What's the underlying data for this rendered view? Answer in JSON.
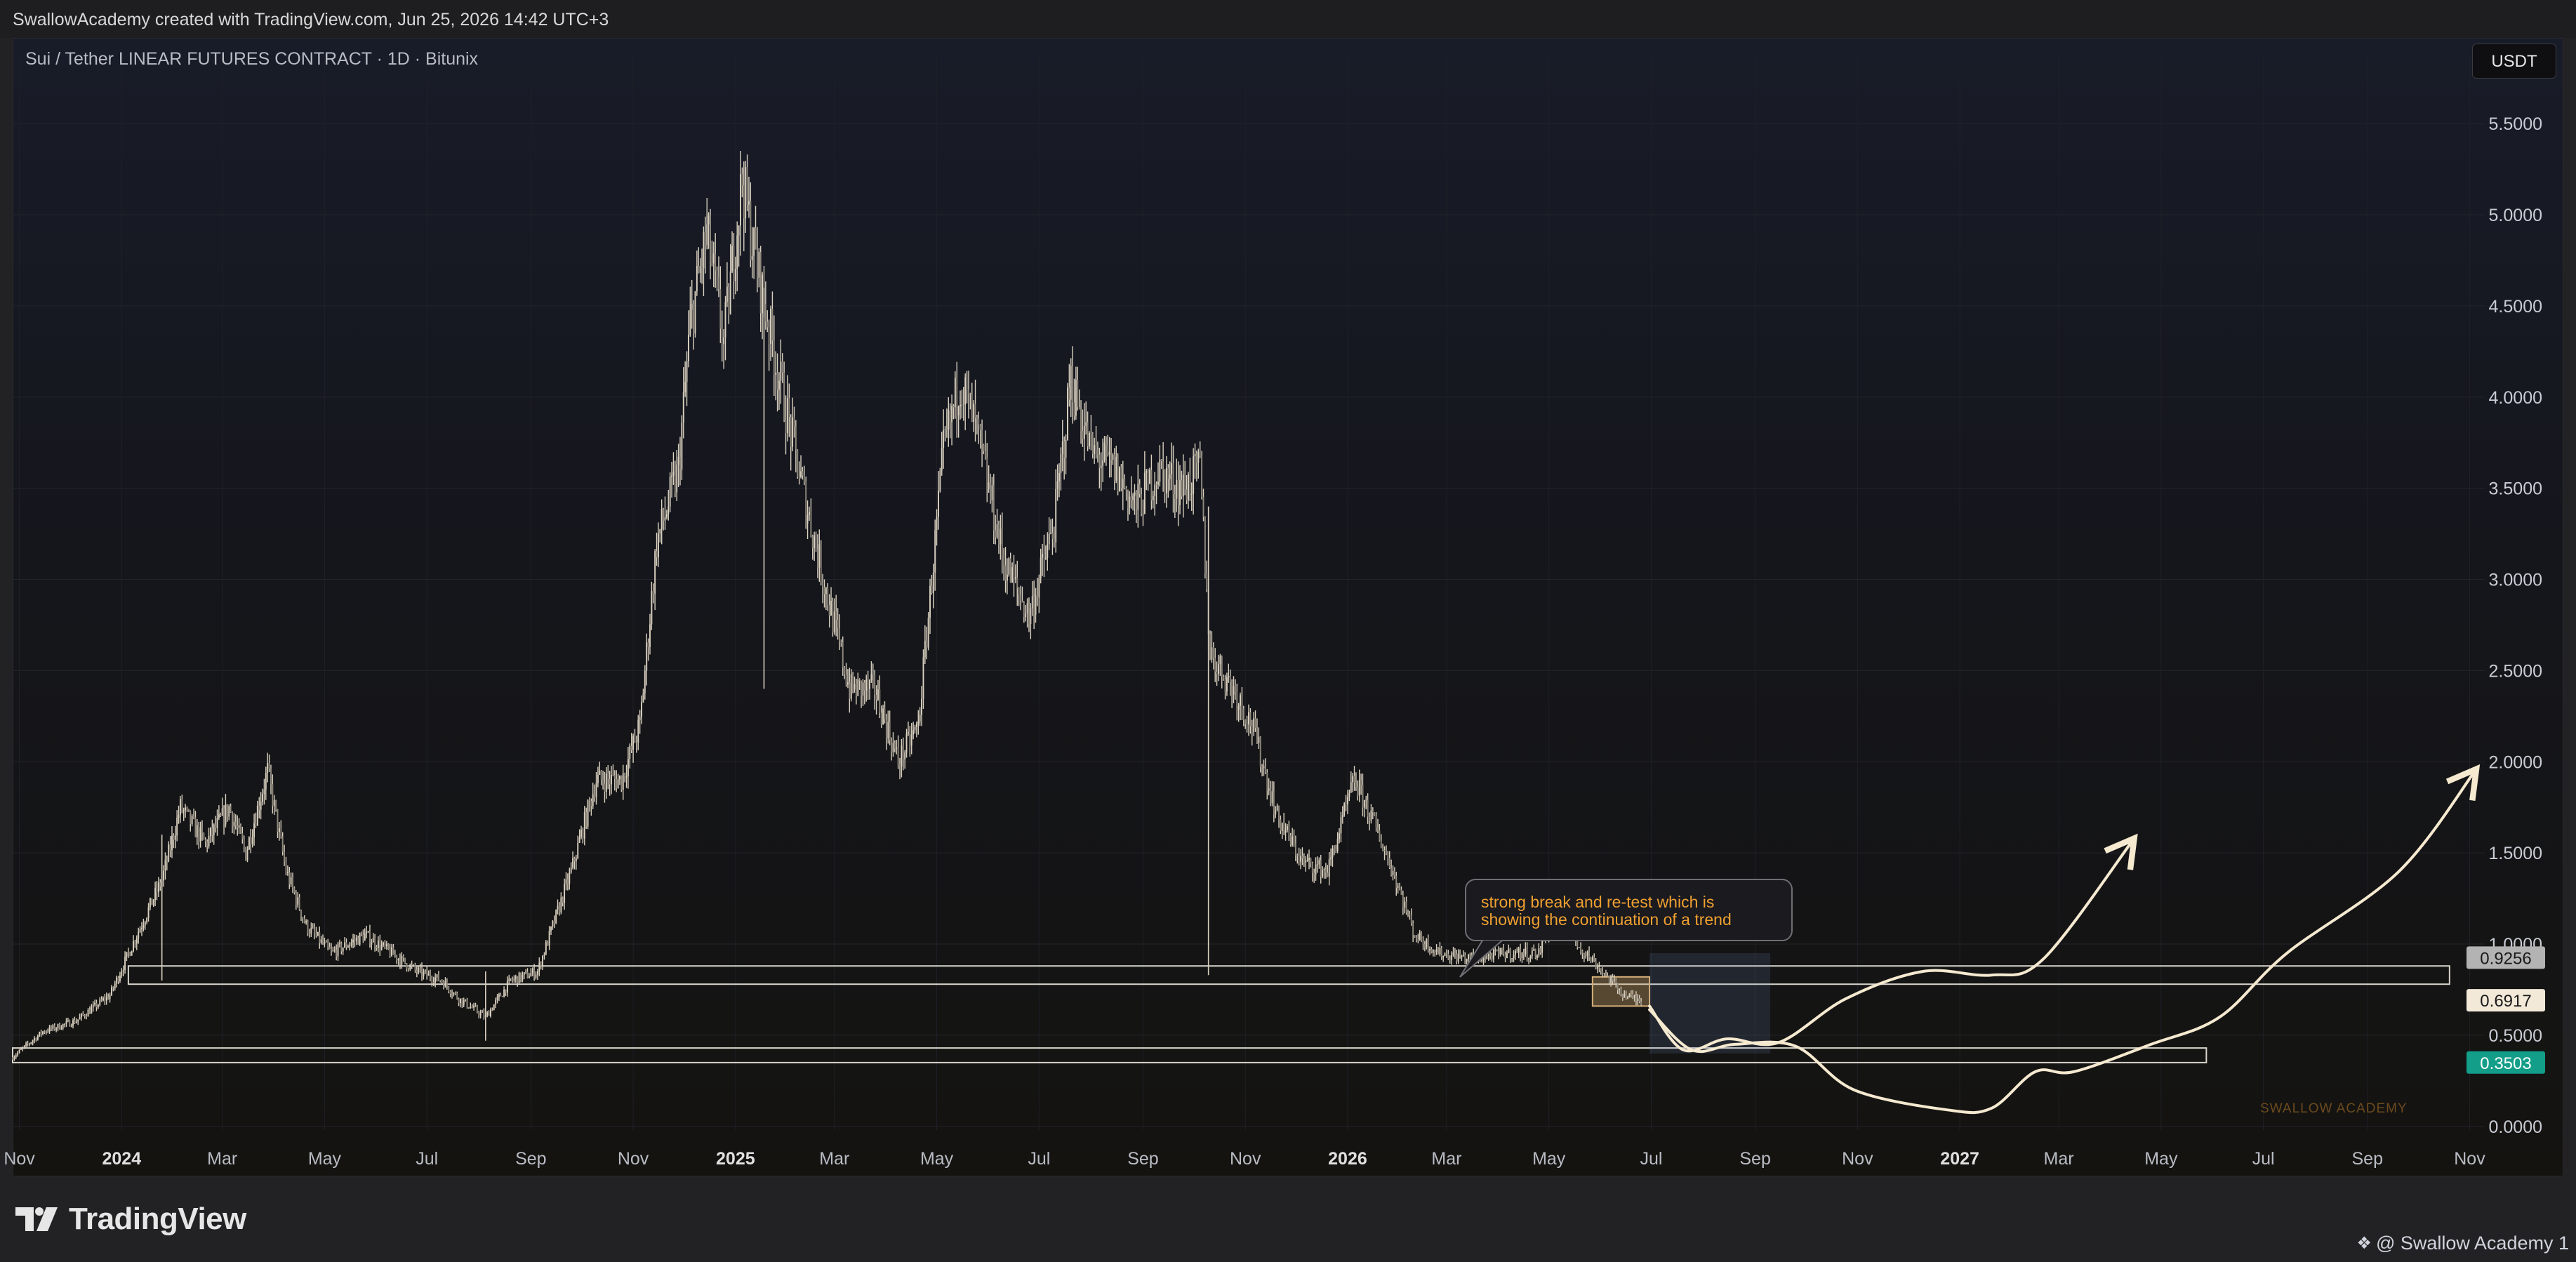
{
  "header": {
    "credit": "SwallowAcademy created with TradingView.com, Jun 25, 2026 14:42 UTC+3"
  },
  "symbol_title": "Sui / Tether LINEAR FUTURES CONTRACT · 1D · Bitunix",
  "currency_button": "USDT",
  "footer": {
    "brand": "TradingView",
    "user": "@ Swallow Academy 1"
  },
  "watermark": "SWALLOW ACADEMY",
  "annotation": {
    "line1": "strong break and re-test which is",
    "line2": "showing the continuation of a trend"
  },
  "colors": {
    "candle": "#d9d0bf",
    "accent_curve": "#f5e9d0",
    "annotation_text": "#f0a030",
    "price_label_green": "#129e89",
    "price_label_grey": "#b3b3b3",
    "price_label_cream": "#f2e9d8"
  },
  "chart_data": {
    "type": "line",
    "x_axis": {
      "range": [
        "2023-10-28",
        "2027-11-10"
      ],
      "tick_labels": [
        {
          "label": "Nov",
          "date": "2023-11-01",
          "bold": false
        },
        {
          "label": "2024",
          "date": "2024-01-01",
          "bold": true
        },
        {
          "label": "Mar",
          "date": "2024-03-01",
          "bold": false
        },
        {
          "label": "May",
          "date": "2024-05-01",
          "bold": false
        },
        {
          "label": "Jul",
          "date": "2024-07-01",
          "bold": false
        },
        {
          "label": "Sep",
          "date": "2024-09-01",
          "bold": false
        },
        {
          "label": "Nov",
          "date": "2024-11-01",
          "bold": false
        },
        {
          "label": "2025",
          "date": "2025-01-01",
          "bold": true
        },
        {
          "label": "Mar",
          "date": "2025-03-01",
          "bold": false
        },
        {
          "label": "May",
          "date": "2025-05-01",
          "bold": false
        },
        {
          "label": "Jul",
          "date": "2025-07-01",
          "bold": false
        },
        {
          "label": "Sep",
          "date": "2025-09-01",
          "bold": false
        },
        {
          "label": "Nov",
          "date": "2025-11-01",
          "bold": false
        },
        {
          "label": "2026",
          "date": "2026-01-01",
          "bold": true
        },
        {
          "label": "Mar",
          "date": "2026-03-01",
          "bold": false
        },
        {
          "label": "May",
          "date": "2026-05-01",
          "bold": false
        },
        {
          "label": "Jul",
          "date": "2026-07-01",
          "bold": false
        },
        {
          "label": "Sep",
          "date": "2026-09-01",
          "bold": false
        },
        {
          "label": "Nov",
          "date": "2026-11-01",
          "bold": false
        },
        {
          "label": "2027",
          "date": "2027-01-01",
          "bold": true
        },
        {
          "label": "Mar",
          "date": "2027-03-01",
          "bold": false
        },
        {
          "label": "May",
          "date": "2027-05-01",
          "bold": false
        },
        {
          "label": "Jul",
          "date": "2027-07-01",
          "bold": false
        },
        {
          "label": "Sep",
          "date": "2027-09-01",
          "bold": false
        },
        {
          "label": "Nov",
          "date": "2027-11-01",
          "bold": false
        }
      ]
    },
    "y_axis": {
      "range": [
        -0.02,
        5.87
      ],
      "tick_labels": [
        "0.0000",
        "0.5000",
        "1.0000",
        "1.5000",
        "2.0000",
        "2.5000",
        "3.0000",
        "3.5000",
        "4.0000",
        "4.5000",
        "5.0000",
        "5.5000"
      ],
      "tick_values": [
        0,
        0.5,
        1.0,
        1.5,
        2.0,
        2.5,
        3.0,
        3.5,
        4.0,
        4.5,
        5.0,
        5.5
      ],
      "price_labels": [
        {
          "text": "0.9256",
          "value": 0.9256,
          "style": "grey"
        },
        {
          "text": "0.6917",
          "value": 0.6917,
          "style": "cream"
        },
        {
          "text": "0.3503",
          "value": 0.3503,
          "style": "green"
        }
      ]
    },
    "series": [
      {
        "points": [
          [
            "2023-10-28",
            0.38
          ],
          [
            "2023-11-15",
            0.52
          ],
          [
            "2023-12-05",
            0.58
          ],
          [
            "2023-12-25",
            0.72
          ],
          [
            "2024-01-10",
            1.05
          ],
          [
            "2024-01-25",
            1.35
          ],
          [
            "2024-02-05",
            1.75
          ],
          [
            "2024-02-20",
            1.55
          ],
          [
            "2024-03-05",
            1.75
          ],
          [
            "2024-03-15",
            1.5
          ],
          [
            "2024-03-28",
            1.95
          ],
          [
            "2024-04-08",
            1.4
          ],
          [
            "2024-04-20",
            1.1
          ],
          [
            "2024-05-05",
            0.95
          ],
          [
            "2024-05-25",
            1.05
          ],
          [
            "2024-06-10",
            0.95
          ],
          [
            "2024-06-25",
            0.85
          ],
          [
            "2024-07-10",
            0.8
          ],
          [
            "2024-07-20",
            0.7
          ],
          [
            "2024-08-05",
            0.6
          ],
          [
            "2024-08-20",
            0.8
          ],
          [
            "2024-09-05",
            0.85
          ],
          [
            "2024-09-25",
            1.4
          ],
          [
            "2024-10-10",
            1.9
          ],
          [
            "2024-10-25",
            1.9
          ],
          [
            "2024-11-05",
            2.2
          ],
          [
            "2024-11-15",
            3.2
          ],
          [
            "2024-11-28",
            3.6
          ],
          [
            "2024-12-05",
            4.4
          ],
          [
            "2024-12-15",
            4.9
          ],
          [
            "2024-12-25",
            4.3
          ],
          [
            "2025-01-05",
            5.2
          ],
          [
            "2025-01-12",
            4.8
          ],
          [
            "2025-01-25",
            4.2
          ],
          [
            "2025-02-10",
            3.5
          ],
          [
            "2025-02-25",
            2.9
          ],
          [
            "2025-03-10",
            2.4
          ],
          [
            "2025-03-25",
            2.4
          ],
          [
            "2025-04-08",
            2.0
          ],
          [
            "2025-04-20",
            2.2
          ],
          [
            "2025-05-05",
            3.7
          ],
          [
            "2025-05-15",
            4.1
          ],
          [
            "2025-05-25",
            3.8
          ],
          [
            "2025-06-10",
            3.1
          ],
          [
            "2025-06-25",
            2.8
          ],
          [
            "2025-07-10",
            3.3
          ],
          [
            "2025-07-20",
            4.1
          ],
          [
            "2025-08-01",
            3.7
          ],
          [
            "2025-08-15",
            3.6
          ],
          [
            "2025-08-28",
            3.4
          ],
          [
            "2025-09-10",
            3.6
          ],
          [
            "2025-09-25",
            3.5
          ],
          [
            "2025-10-05",
            3.6
          ],
          [
            "2025-10-11",
            2.6
          ],
          [
            "2025-10-25",
            2.4
          ],
          [
            "2025-11-05",
            2.2
          ],
          [
            "2025-11-20",
            1.7
          ],
          [
            "2025-12-05",
            1.45
          ],
          [
            "2025-12-20",
            1.4
          ],
          [
            "2026-01-05",
            1.9
          ],
          [
            "2026-01-15",
            1.7
          ],
          [
            "2026-01-28",
            1.4
          ],
          [
            "2026-02-10",
            1.05
          ],
          [
            "2026-02-25",
            0.95
          ],
          [
            "2026-03-15",
            0.92
          ],
          [
            "2026-04-05",
            0.95
          ],
          [
            "2026-04-25",
            0.95
          ],
          [
            "2026-05-05",
            1.2
          ],
          [
            "2026-05-18",
            1.0
          ],
          [
            "2026-06-01",
            0.86
          ],
          [
            "2026-06-15",
            0.72
          ],
          [
            "2026-06-25",
            0.69
          ]
        ]
      }
    ],
    "spike_wicks": [
      {
        "date": "2025-01-18",
        "low": 2.4,
        "high": 4.6
      },
      {
        "date": "2025-10-10",
        "low": 0.83,
        "high": 3.4
      },
      {
        "date": "2024-08-05",
        "low": 0.47,
        "high": 0.85
      },
      {
        "date": "2024-01-25",
        "low": 0.8,
        "high": 1.6
      }
    ],
    "zones": [
      {
        "x1": "2024-01-05",
        "x2": "2027-10-20",
        "y_low": 0.78,
        "y_high": 0.88
      },
      {
        "x1": "2023-10-28",
        "x2": "2027-05-28",
        "y_low": 0.35,
        "y_high": 0.43
      },
      {
        "x1": "2026-05-27",
        "x2": "2026-06-30",
        "y_low": 0.66,
        "y_high": 0.82,
        "fill": true
      }
    ],
    "projection_box": {
      "x1": "2026-06-30",
      "x2": "2026-09-10",
      "y_low": 0.4,
      "y_high": 0.95
    },
    "projections": [
      {
        "points": [
          [
            "2026-06-30",
            0.66
          ],
          [
            "2026-07-20",
            0.42
          ],
          [
            "2026-08-15",
            0.48
          ],
          [
            "2026-09-15",
            0.46
          ],
          [
            "2026-10-25",
            0.7
          ],
          [
            "2026-12-10",
            0.85
          ],
          [
            "2027-01-20",
            0.83
          ],
          [
            "2027-02-20",
            0.92
          ],
          [
            "2027-04-15",
            1.58
          ]
        ]
      },
      {
        "points": [
          [
            "2026-06-30",
            0.64
          ],
          [
            "2026-07-25",
            0.42
          ],
          [
            "2026-08-20",
            0.45
          ],
          [
            "2026-09-25",
            0.44
          ],
          [
            "2026-10-30",
            0.2
          ],
          [
            "2026-12-25",
            0.09
          ],
          [
            "2027-01-20",
            0.1
          ],
          [
            "2027-02-15",
            0.3
          ],
          [
            "2027-03-10",
            0.3
          ],
          [
            "2027-04-25",
            0.45
          ],
          [
            "2027-06-05",
            0.6
          ],
          [
            "2027-07-15",
            0.95
          ],
          [
            "2027-09-20",
            1.4
          ],
          [
            "2027-11-05",
            1.96
          ]
        ]
      }
    ]
  }
}
